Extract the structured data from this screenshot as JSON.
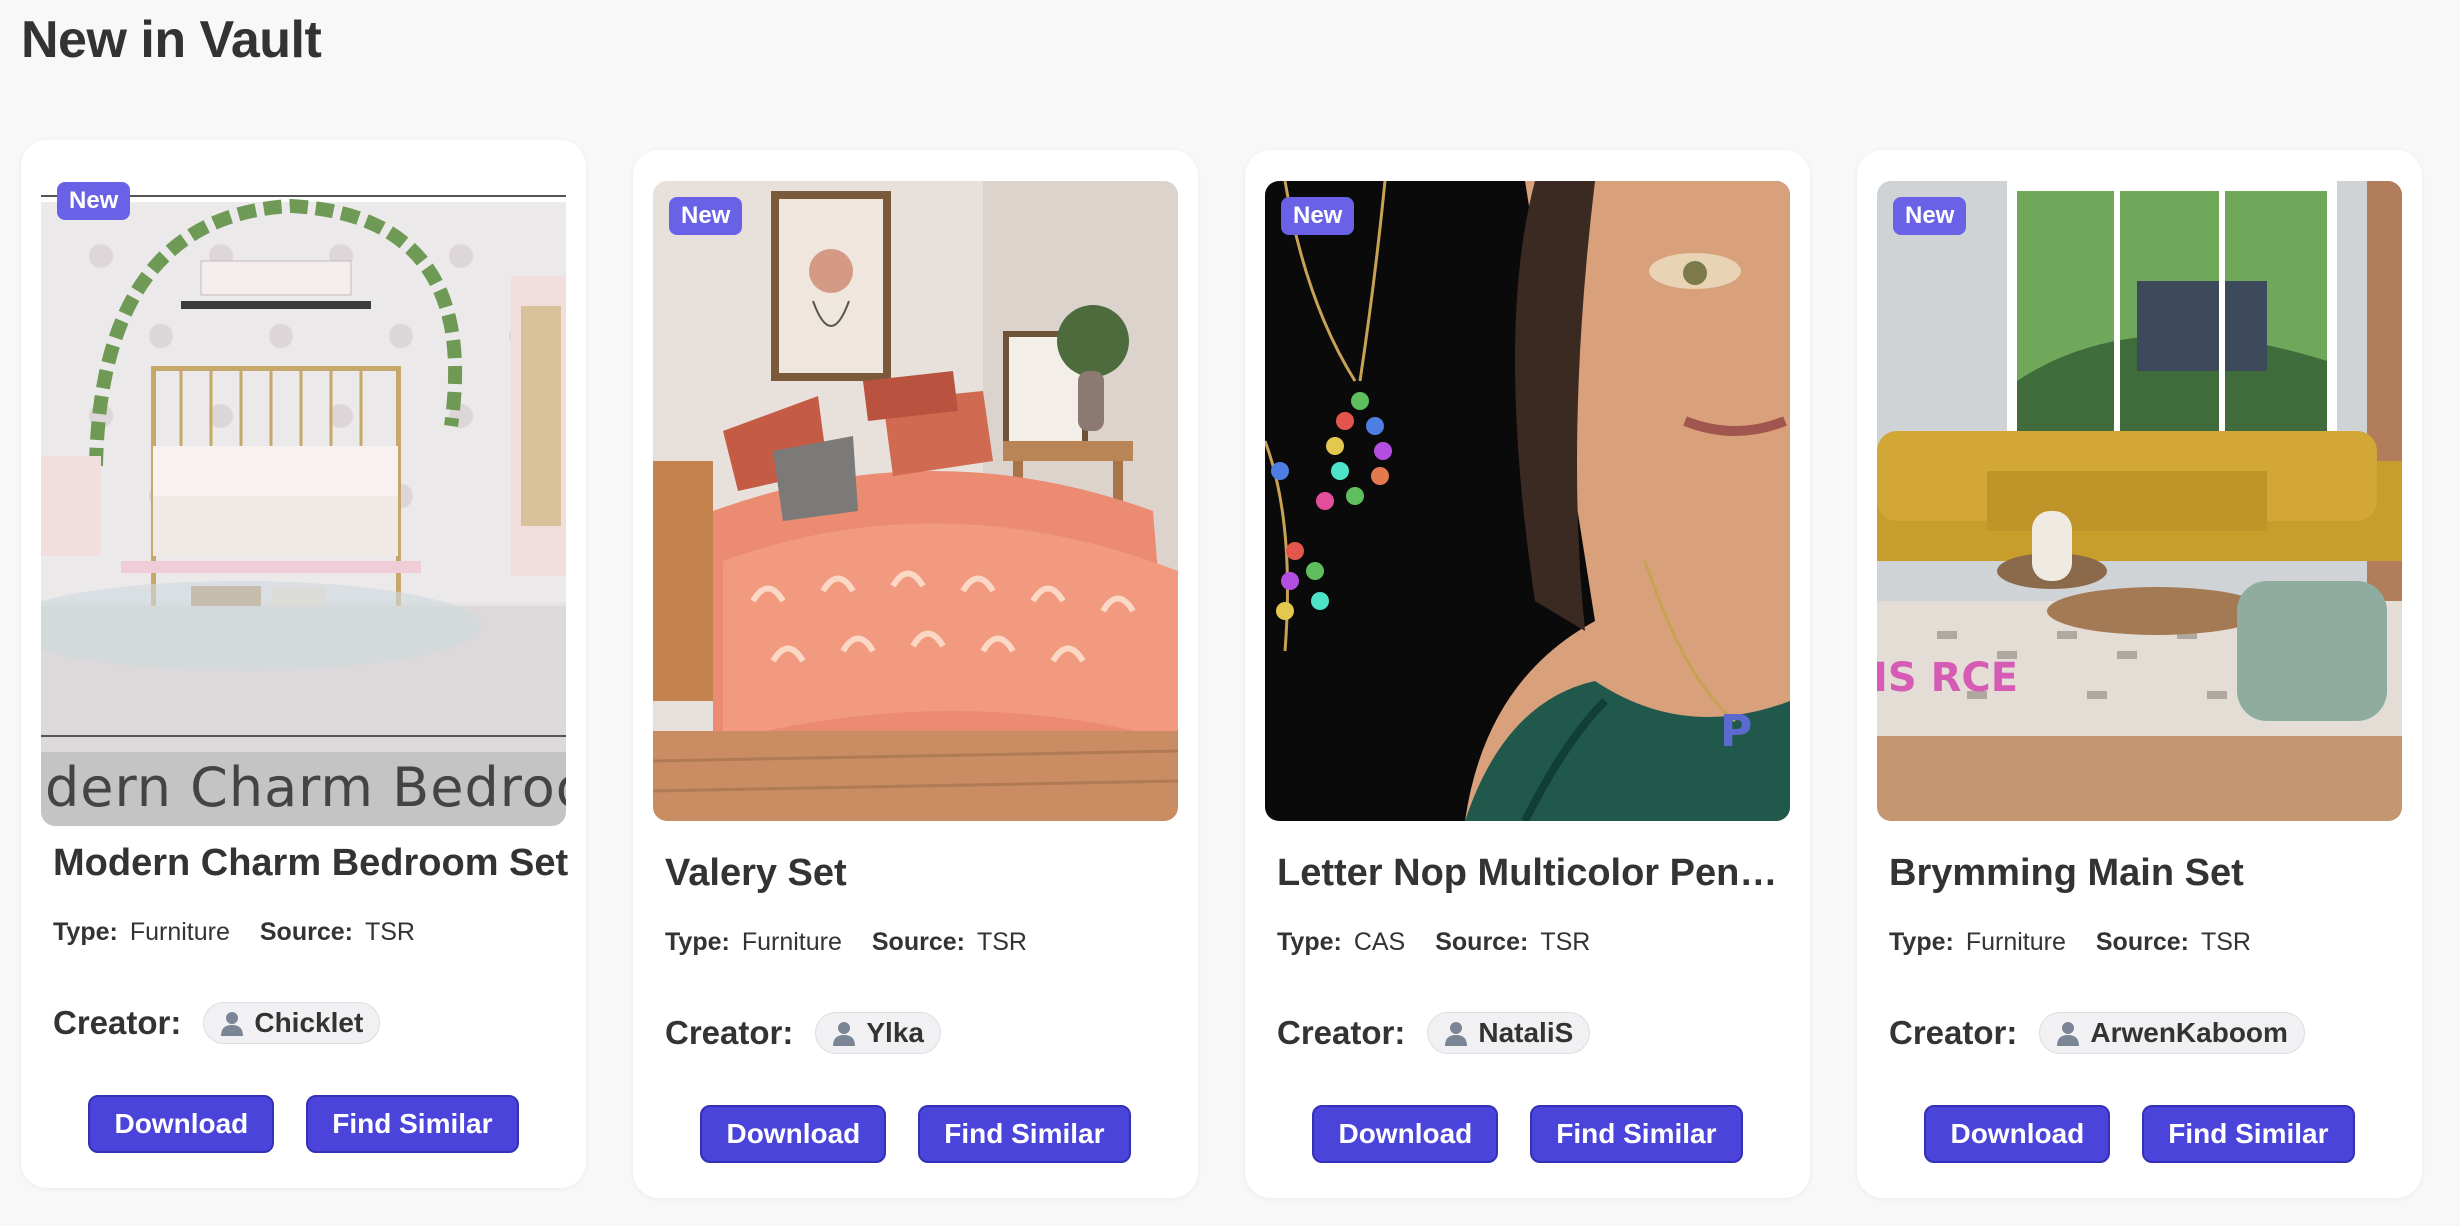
{
  "header": {
    "title": "New in Vault"
  },
  "labels": {
    "type": "Type:",
    "source": "Source:",
    "creator": "Creator:",
    "badge": "New",
    "download": "Download",
    "find_similar": "Find Similar"
  },
  "cards": [
    {
      "title": "Modern Charm Bedroom Set",
      "type": "Furniture",
      "source": "TSR",
      "creator": "Chicklet",
      "thumb_text": "dern Charm Bedroo"
    },
    {
      "title": "Valery Set",
      "type": "Furniture",
      "source": "TSR",
      "creator": "Ylka"
    },
    {
      "title": "Letter Nop Multicolor Pendant",
      "type": "CAS",
      "source": "TSR",
      "creator": "NataliS"
    },
    {
      "title": "Brymming Main Set",
      "type": "Furniture",
      "source": "TSR",
      "creator": "ArwenKaboom",
      "thumb_text": "IS RCE"
    }
  ],
  "colors": {
    "accent": "#4a44db",
    "badge": "#6a62e6",
    "background": "#f8f8f8"
  }
}
